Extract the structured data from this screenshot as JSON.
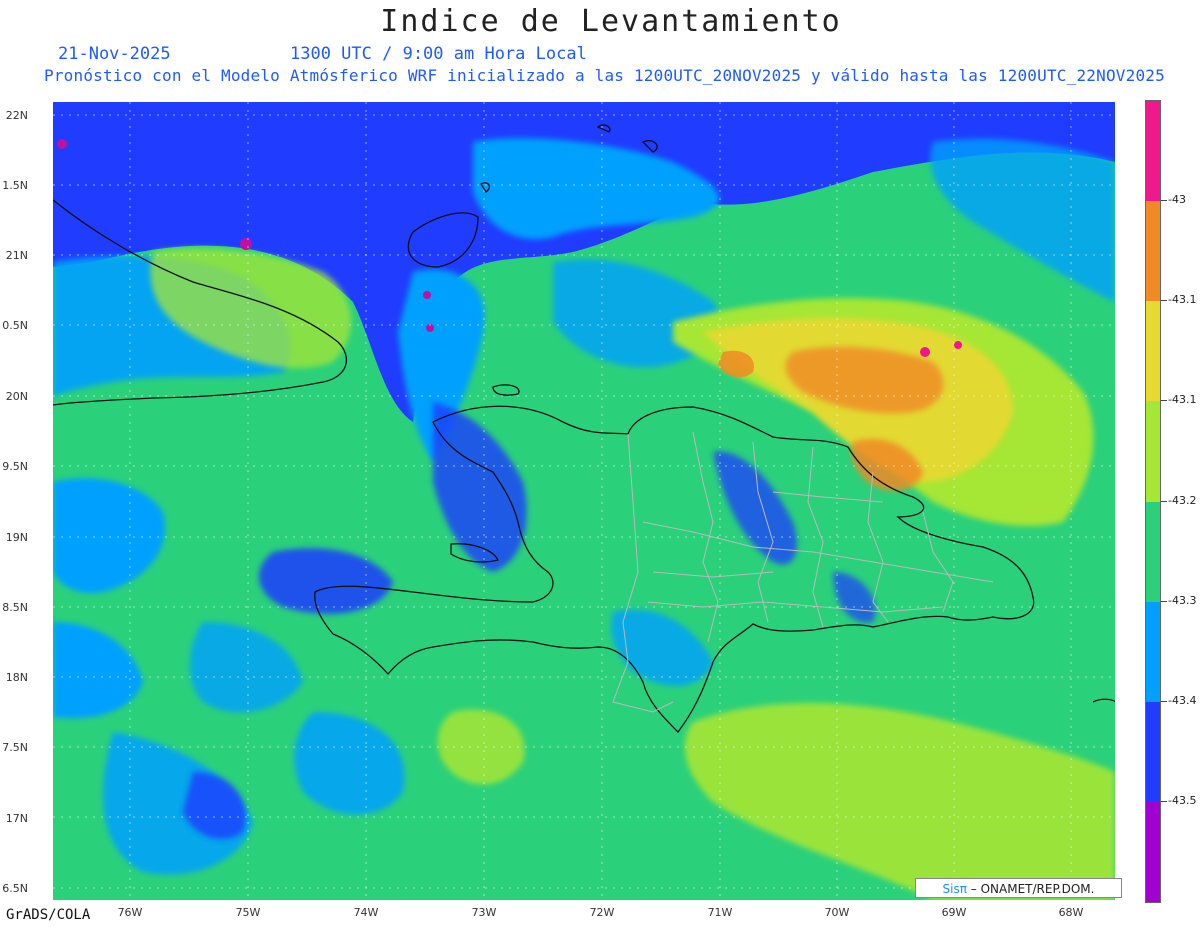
{
  "header": {
    "title": "Indice de Levantamiento",
    "date": "21-Nov-2025",
    "time": "1300 UTC / 9:00 am Hora Local",
    "forecast": "Pronóstico con el Modelo Atmósferico WRF inicializado a las 1200UTC_20NOV2025 y válido hasta las  1200UTC_22NOV2025"
  },
  "axes": {
    "lat_labels": [
      "22N",
      "1.5N",
      "21N",
      "0.5N",
      "20N",
      "9.5N",
      "19N",
      "8.5N",
      "18N",
      "7.5N",
      "17N",
      "6.5N"
    ],
    "lon_labels": [
      "76W",
      "75W",
      "74W",
      "73W",
      "72W",
      "71W",
      "70W",
      "69W",
      "68W"
    ]
  },
  "legend": {
    "labels": [
      "-43",
      "-43.1",
      "-43.1",
      "-43.2",
      "-43.3",
      "-43.4",
      "-43.5"
    ],
    "colors": [
      "#a000d0",
      "#1f3cff",
      "#00a0ff",
      "#2bd07b",
      "#a6e635",
      "#e6d930",
      "#f08a25",
      "#f0188c"
    ]
  },
  "footer": {
    "brand": "GrADS/COLA",
    "credit_logo": "Sisπ",
    "credit_text": "– ONAMET/REP.DOM."
  }
}
